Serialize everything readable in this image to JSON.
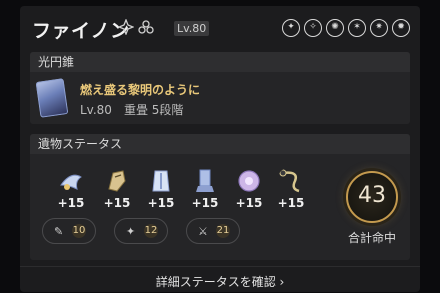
{
  "character": {
    "name": "ファイノン",
    "level": "Lv.80",
    "path_icon": "destruction-path-icon",
    "element_icon": "physical-element-icon"
  },
  "element_icons": [
    "trace-icon-1",
    "trace-icon-2",
    "trace-icon-3",
    "trace-icon-4",
    "trace-icon-5",
    "trace-icon-6"
  ],
  "light_cone": {
    "section_title": "光円錐",
    "name": "燃え盛る黎明のように",
    "meta": "Lv.80　重畳 5段階"
  },
  "relics": {
    "section_title": "遺物ステータス",
    "items": [
      {
        "plus": "+15",
        "icon": "relic-head-icon",
        "color": "#c9d6f0"
      },
      {
        "plus": "+15",
        "icon": "relic-hands-icon",
        "color": "#d9c38f"
      },
      {
        "plus": "+15",
        "icon": "relic-body-icon",
        "color": "#d8e3f5"
      },
      {
        "plus": "+15",
        "icon": "relic-feet-icon",
        "color": "#aebfe6"
      },
      {
        "plus": "+15",
        "icon": "relic-sphere-icon",
        "color": "#cdb6e8"
      },
      {
        "plus": "+15",
        "icon": "relic-rope-icon",
        "color": "#d6c68e"
      }
    ],
    "substat_pills": [
      {
        "icon": "crit-rate-icon",
        "count": "10"
      },
      {
        "icon": "crit-dmg-icon",
        "count": "12"
      },
      {
        "icon": "atk-icon",
        "count": "21"
      }
    ]
  },
  "score": {
    "value": "43",
    "label": "合計命中"
  },
  "footer": {
    "link": "詳細ステータスを確認 ›"
  }
}
